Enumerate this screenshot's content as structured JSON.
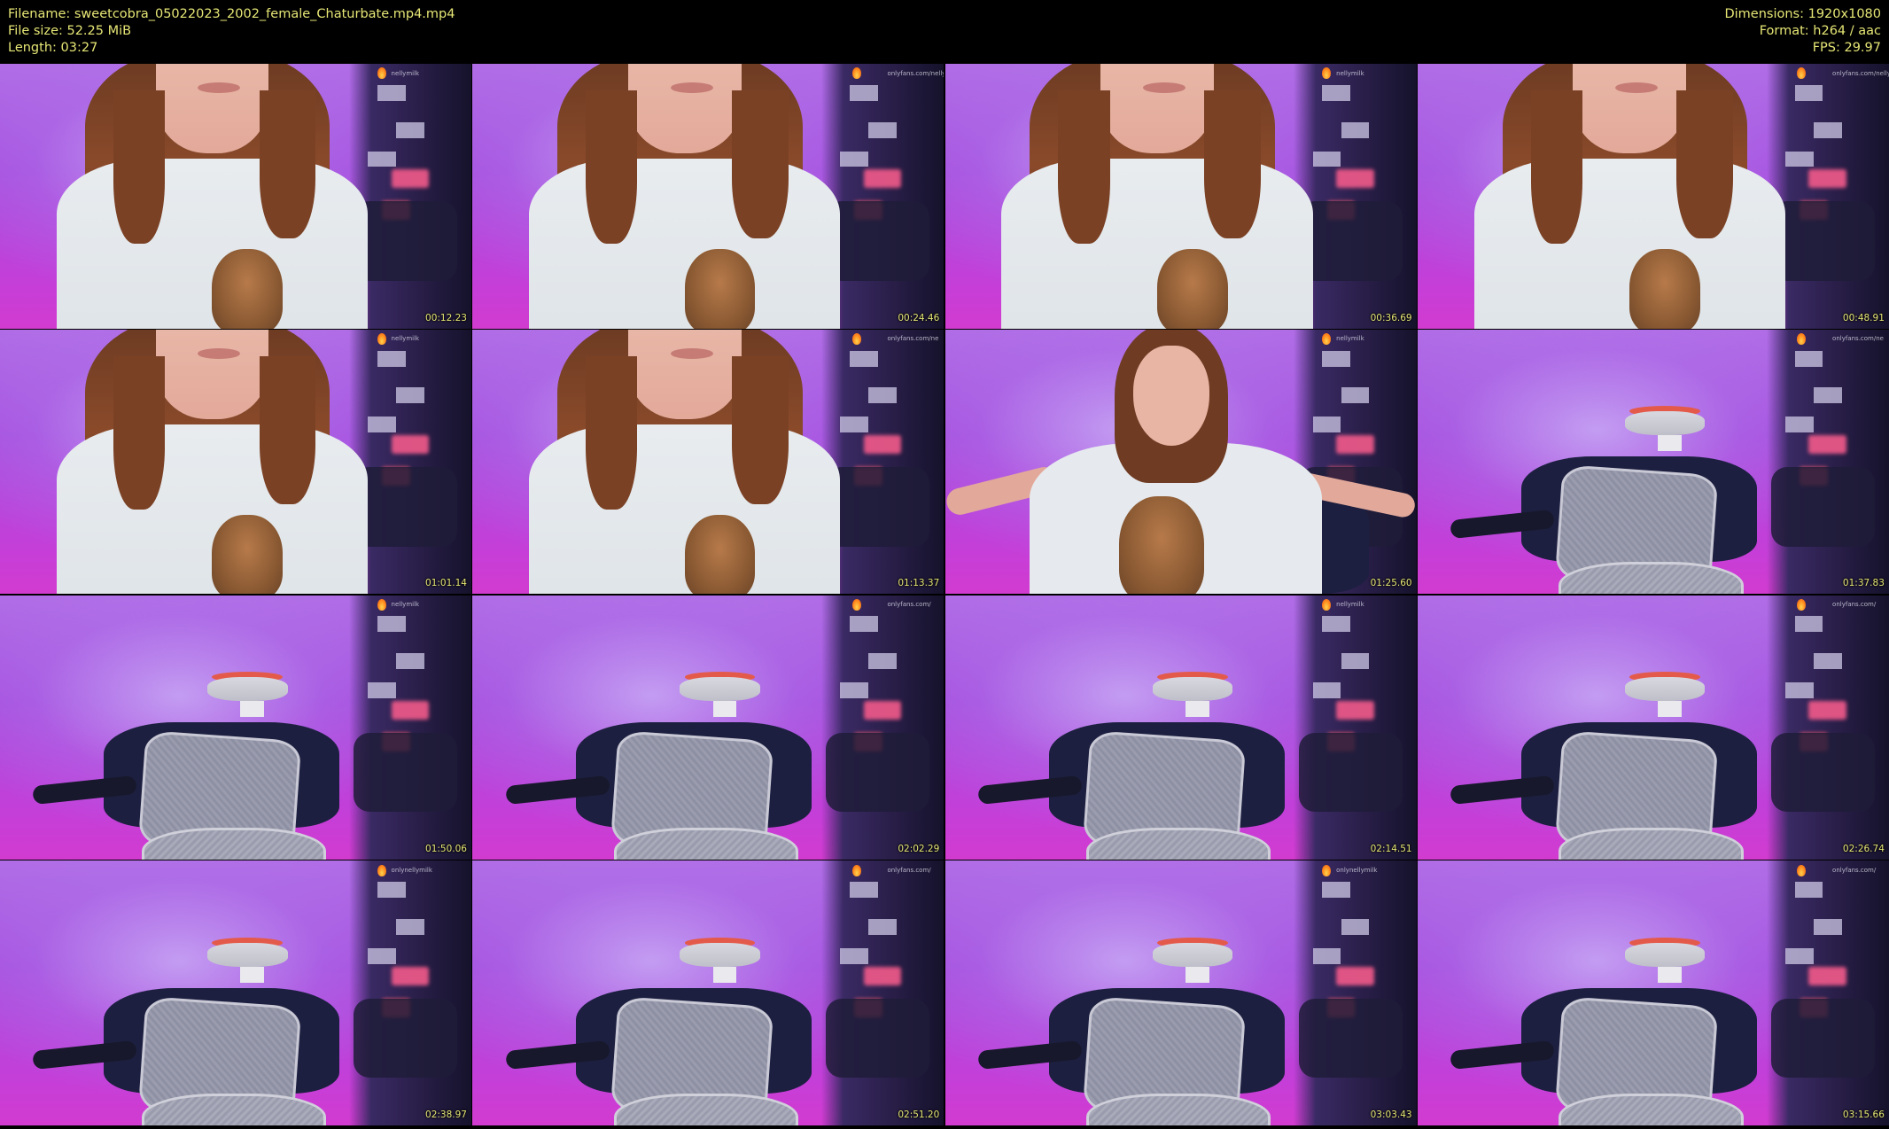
{
  "header": {
    "filename": "Filename: sweetcobra_05022023_2002_female_Chaturbate.mp4.mp4",
    "filesize": "File size: 52.25 MiB",
    "length": "Length: 03:27",
    "dimensions": "Dimensions: 1920x1080",
    "format": "Format: h264 / aac",
    "fps": "FPS: 29.97"
  },
  "colors": {
    "text": "#e6e676",
    "background": "#000000",
    "wall": "#a74fdf"
  },
  "thumbnails": [
    {
      "timestamp": "00:12.23",
      "scene": "closeup",
      "watermark": "nellymilk"
    },
    {
      "timestamp": "00:24.46",
      "scene": "closeup",
      "watermark": "onlyfans.com/nelly"
    },
    {
      "timestamp": "00:36.69",
      "scene": "closeup",
      "watermark": "nellymilk"
    },
    {
      "timestamp": "00:48.91",
      "scene": "closeup",
      "watermark": "onlyfans.com/nelly"
    },
    {
      "timestamp": "01:01.14",
      "scene": "closeup",
      "watermark": "nellymilk"
    },
    {
      "timestamp": "01:13.37",
      "scene": "closeup",
      "watermark": "onlyfans.com/ne"
    },
    {
      "timestamp": "01:25.60",
      "scene": "wide",
      "watermark": "nellymilk"
    },
    {
      "timestamp": "01:37.83",
      "scene": "chair",
      "watermark": "onlyfans.com/ne"
    },
    {
      "timestamp": "01:50.06",
      "scene": "chair",
      "watermark": "nellymilk"
    },
    {
      "timestamp": "02:02.29",
      "scene": "chair",
      "watermark": "onlyfans.com/"
    },
    {
      "timestamp": "02:14.51",
      "scene": "chair",
      "watermark": "nellymilk"
    },
    {
      "timestamp": "02:26.74",
      "scene": "chair",
      "watermark": "onlyfans.com/"
    },
    {
      "timestamp": "02:38.97",
      "scene": "chair",
      "watermark": "onlynellymilk"
    },
    {
      "timestamp": "02:51.20",
      "scene": "chair",
      "watermark": "onlyfans.com/"
    },
    {
      "timestamp": "03:03.43",
      "scene": "chair",
      "watermark": "onlynellymilk"
    },
    {
      "timestamp": "03:15.66",
      "scene": "chair",
      "watermark": "onlyfans.com/"
    }
  ]
}
